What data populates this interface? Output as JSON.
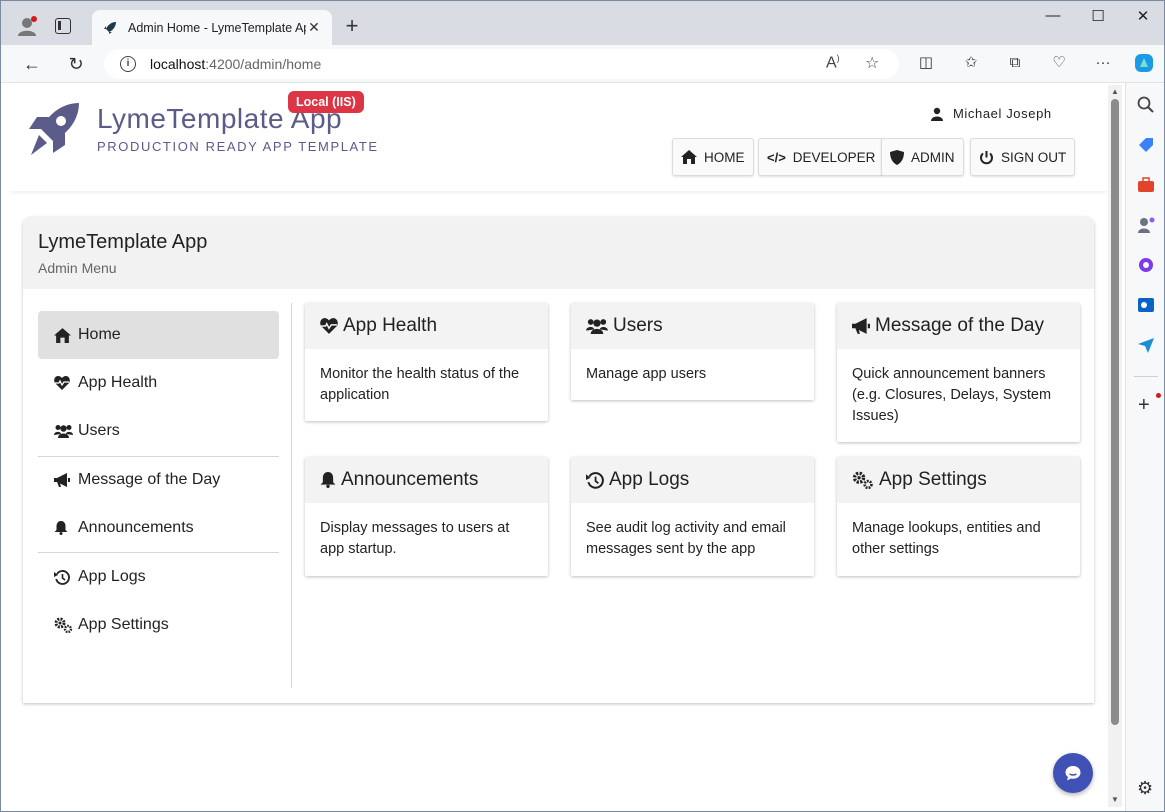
{
  "browser": {
    "tab_title": "Admin Home - LymeTemplate Ap",
    "url_host": "localhost",
    "url_path": ":4200/admin/home",
    "window_controls": {
      "minimize": "—",
      "maximize": "☐",
      "close": "✕"
    },
    "new_tab": "+"
  },
  "header": {
    "app_title": "LymeTemplate App",
    "app_subtitle": "PRODUCTION READY APP TEMPLATE",
    "env_badge": "Local (IIS)",
    "user_name": "Michael Joseph",
    "nav": {
      "home": "HOME",
      "developer": "DEVELOPER",
      "admin": "ADMIN",
      "sign_out": "SIGN OUT"
    }
  },
  "card": {
    "title": "LymeTemplate App",
    "subtitle": "Admin Menu"
  },
  "menu": [
    {
      "label": "Home",
      "icon": "home-icon",
      "active": true
    },
    {
      "label": "App Health",
      "icon": "heartbeat-icon"
    },
    {
      "label": "Users",
      "icon": "users-icon"
    },
    {
      "label": "Message of the Day",
      "icon": "bullhorn-icon"
    },
    {
      "label": "Announcements",
      "icon": "bell-icon"
    },
    {
      "label": "App Logs",
      "icon": "history-icon"
    },
    {
      "label": "App Settings",
      "icon": "cogs-icon"
    }
  ],
  "tiles": [
    {
      "title": "App Health",
      "icon": "heartbeat-icon",
      "body": "Monitor the health status of the application"
    },
    {
      "title": "Users",
      "icon": "users-icon",
      "body": "Manage app users"
    },
    {
      "title": "Message of the Day",
      "icon": "bullhorn-icon",
      "body": "Quick announcement banners (e.g. Closures, Delays, System Issues)"
    },
    {
      "title": "Announcements",
      "icon": "bell-icon",
      "body": "Display messages to users at app startup."
    },
    {
      "title": "App Logs",
      "icon": "history-icon",
      "body": "See audit log activity and email messages sent by the app"
    },
    {
      "title": "App Settings",
      "icon": "cogs-icon",
      "body": "Manage lookups, entities and other settings"
    }
  ],
  "colors": {
    "brand": "#5b5b8a",
    "badge": "#dc3545",
    "fab": "#3f51b5"
  }
}
